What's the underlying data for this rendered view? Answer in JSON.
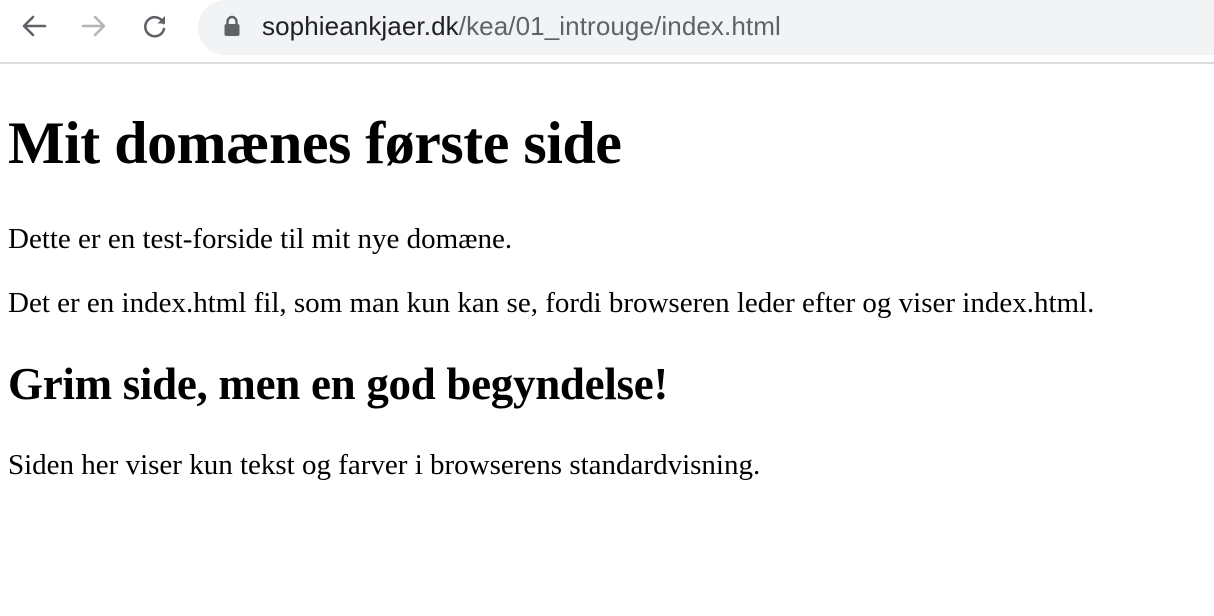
{
  "browser": {
    "back_icon": "arrow-left-icon",
    "forward_icon": "arrow-right-icon",
    "reload_icon": "reload-icon",
    "lock_icon": "lock-icon",
    "url_host": "sophieankjaer.dk",
    "url_path": "/kea/01_introuge/index.html"
  },
  "page": {
    "heading": "Mit domænes første side",
    "paragraph_1": "Dette er en test-forside til mit nye domæne.",
    "paragraph_2": "Det er en index.html fil, som man kun kan se, fordi browseren leder efter og viser index.html.",
    "subheading": "Grim side, men en god begyndelse!",
    "paragraph_3": "Siden her viser kun tekst og farver i browserens standardvisning."
  },
  "colors": {
    "toolbar_bg": "#ffffff",
    "omnibox_bg": "#f1f3f4",
    "icon_active": "#5f6368",
    "icon_disabled": "#b3b6b9",
    "url_host": "#202124",
    "url_path": "#5f6368",
    "page_text": "#000000"
  }
}
